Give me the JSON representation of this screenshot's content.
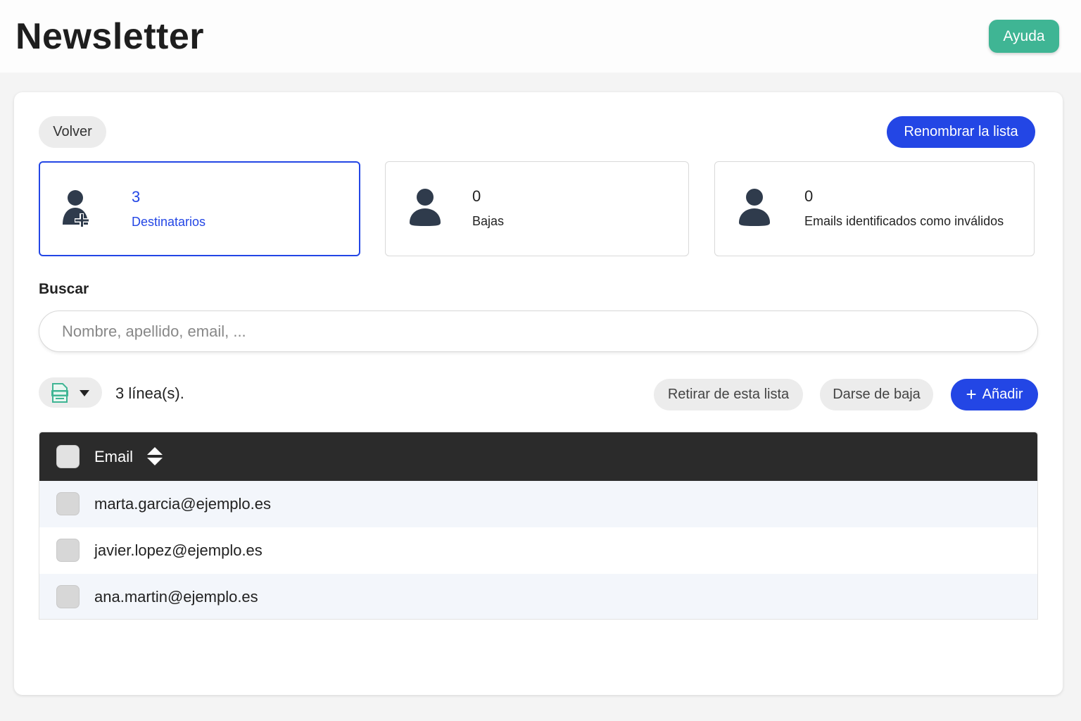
{
  "header": {
    "title": "Newsletter",
    "help_label": "Ayuda"
  },
  "toolbar": {
    "back_label": "Volver",
    "rename_label": "Renombrar la lista"
  },
  "stats": [
    {
      "value": "3",
      "label": "Destinatarios",
      "icon": "user-plus-icon",
      "active": true
    },
    {
      "value": "0",
      "label": "Bajas",
      "icon": "user-icon",
      "active": false
    },
    {
      "value": "0",
      "label": "Emails identificados como inválidos",
      "icon": "user-icon",
      "active": false
    }
  ],
  "search": {
    "label": "Buscar",
    "placeholder": "Nombre, apellido, email, ...",
    "value": ""
  },
  "actions": {
    "export_icon": "excel-export-icon",
    "lines_count": "3 línea(s).",
    "remove_from_list_label": "Retirar de esta lista",
    "unsubscribe_label": "Darse de baja",
    "add_label": "Añadir"
  },
  "table": {
    "columns": [
      "Email"
    ],
    "rows": [
      {
        "email": "marta.garcia@ejemplo.es"
      },
      {
        "email": "javier.lopez@ejemplo.es"
      },
      {
        "email": "ana.martin@ejemplo.es"
      }
    ]
  },
  "colors": {
    "accent": "#2346e5",
    "help": "#3fb594",
    "table_header": "#2b2b2b",
    "row_alt": "#f3f6fb"
  }
}
